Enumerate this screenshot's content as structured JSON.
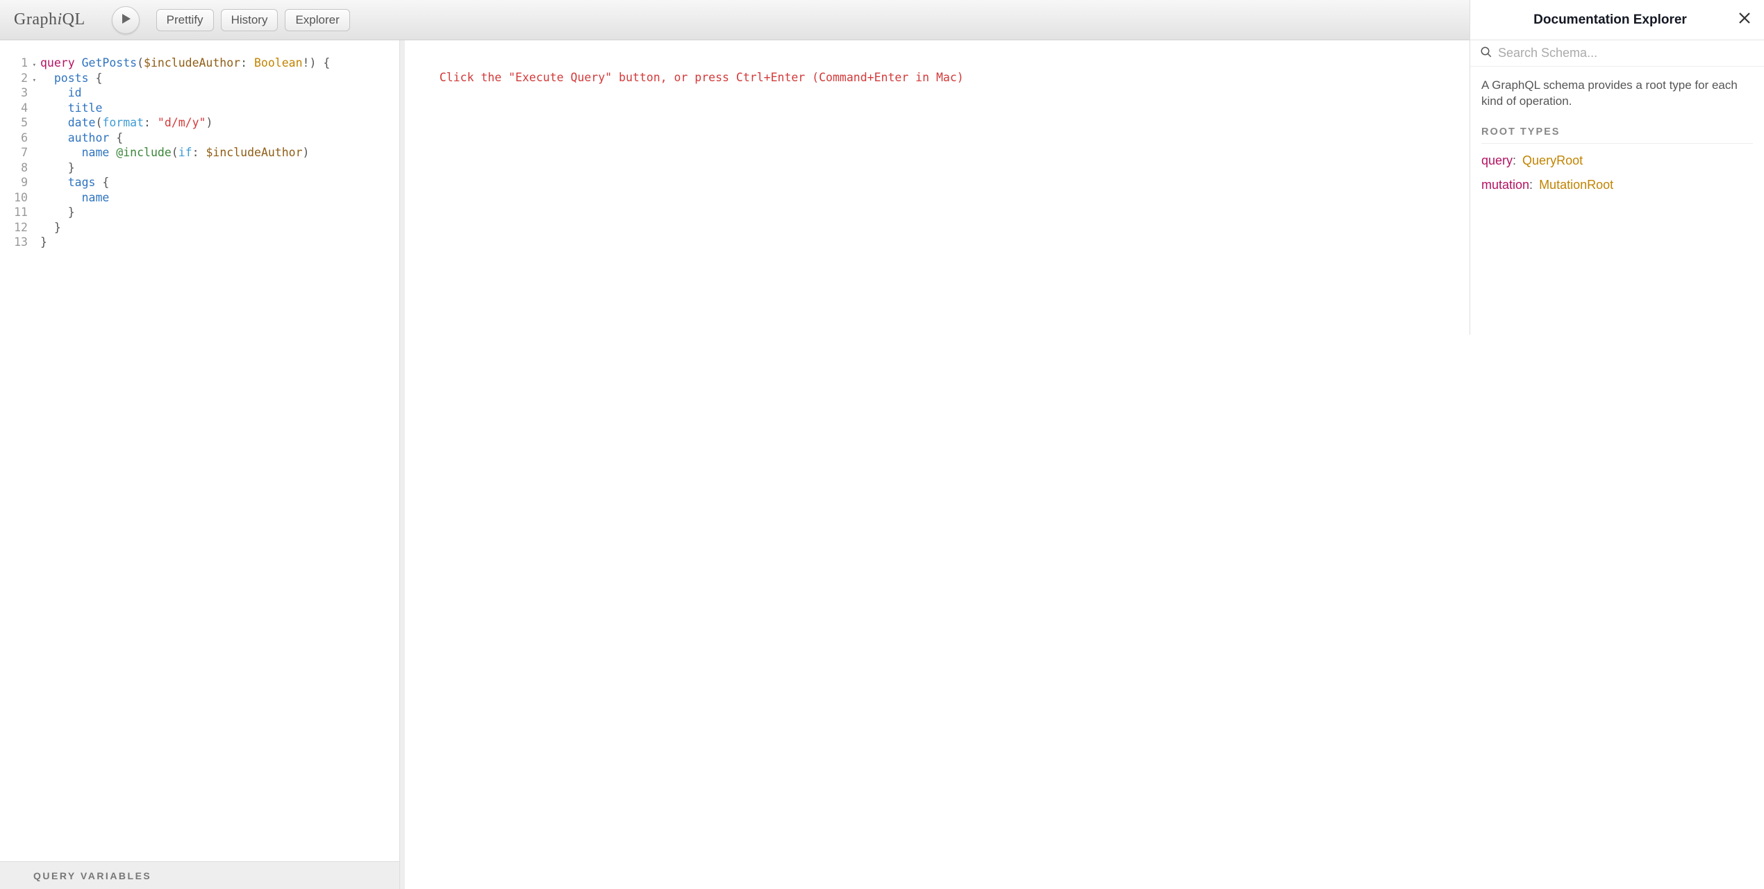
{
  "app": {
    "logo_prefix": "Graph",
    "logo_em": "i",
    "logo_suffix": "QL"
  },
  "toolbar": {
    "prettify": "Prettify",
    "history": "History",
    "explorer": "Explorer"
  },
  "editor": {
    "line_count": 13,
    "fold_lines": [
      1,
      2
    ],
    "tokens": [
      [
        [
          "kw",
          "query"
        ],
        [
          "punct",
          " "
        ],
        [
          "def",
          "GetPosts"
        ],
        [
          "punct",
          "("
        ],
        [
          "var",
          "$includeAuthor"
        ],
        [
          "punct",
          ": "
        ],
        [
          "atom",
          "Boolean"
        ],
        [
          "punct",
          "!"
        ],
        [
          "punct",
          ") {"
        ]
      ],
      [
        [
          "punct",
          "  "
        ],
        [
          "prop",
          "posts"
        ],
        [
          "punct",
          " {"
        ]
      ],
      [
        [
          "punct",
          "    "
        ],
        [
          "prop",
          "id"
        ]
      ],
      [
        [
          "punct",
          "    "
        ],
        [
          "prop",
          "title"
        ]
      ],
      [
        [
          "punct",
          "    "
        ],
        [
          "prop",
          "date"
        ],
        [
          "punct",
          "("
        ],
        [
          "attr",
          "format"
        ],
        [
          "punct",
          ": "
        ],
        [
          "str",
          "\"d/m/y\""
        ],
        [
          "punct",
          ")"
        ]
      ],
      [
        [
          "punct",
          "    "
        ],
        [
          "prop",
          "author"
        ],
        [
          "punct",
          " {"
        ]
      ],
      [
        [
          "punct",
          "      "
        ],
        [
          "prop",
          "name"
        ],
        [
          "punct",
          " "
        ],
        [
          "meta",
          "@include"
        ],
        [
          "punct",
          "("
        ],
        [
          "attr",
          "if"
        ],
        [
          "punct",
          ": "
        ],
        [
          "var",
          "$includeAuthor"
        ],
        [
          "punct",
          ")"
        ]
      ],
      [
        [
          "punct",
          "    }"
        ]
      ],
      [
        [
          "punct",
          "    "
        ],
        [
          "prop",
          "tags"
        ],
        [
          "punct",
          " {"
        ]
      ],
      [
        [
          "punct",
          "      "
        ],
        [
          "prop",
          "name"
        ]
      ],
      [
        [
          "punct",
          "    }"
        ]
      ],
      [
        [
          "punct",
          "  }"
        ]
      ],
      [
        [
          "punct",
          "}"
        ]
      ]
    ]
  },
  "variables_label": "Query Variables",
  "result_placeholder": "Click the \"Execute Query\" button, or press Ctrl+Enter (Command+Enter in Mac)",
  "docs": {
    "title": "Documentation Explorer",
    "search_placeholder": "Search Schema...",
    "description": "A GraphQL schema provides a root type for each kind of operation.",
    "section": "ROOT TYPES",
    "roots": [
      {
        "field": "query",
        "type": "QueryRoot"
      },
      {
        "field": "mutation",
        "type": "MutationRoot"
      }
    ]
  }
}
